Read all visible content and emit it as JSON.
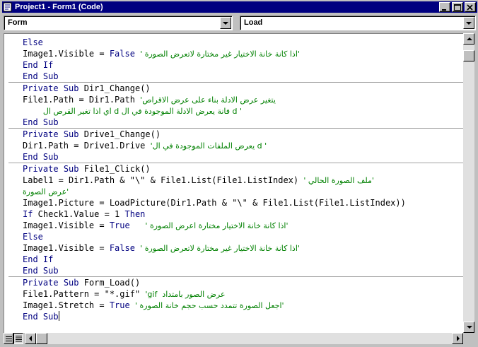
{
  "window": {
    "title": "Project1 - Form1 (Code)"
  },
  "object_combo": {
    "value": "Form"
  },
  "procedure_combo": {
    "value": "Load"
  },
  "code": {
    "lines": [
      {
        "code": "Else",
        "comment": ""
      },
      {
        "code": "Image1.Visible = False ",
        "comment": "' اذا كانة خانة الاختيار غير مختارة لاتعرض الصورة'"
      },
      {
        "code": "End If",
        "comment": ""
      },
      {
        "code": "End Sub",
        "comment": ""
      },
      {
        "separator": true
      },
      {
        "code": "Private Sub Dir1_Change()",
        "comment": ""
      },
      {
        "code": "File1.Path = Dir1.Path ",
        "comment": "'يتغير عرض الادلة بناء على عرض الاقراص"
      },
      {
        "code": "    ",
        "comment": "اي اذا تغير القرص ال d فانة يعرض الادلة الموجودة في ال d '"
      },
      {
        "code": "End Sub",
        "comment": ""
      },
      {
        "separator": true
      },
      {
        "code": "Private Sub Drive1_Change()",
        "comment": ""
      },
      {
        "code": "Dir1.Path = Drive1.Drive ",
        "comment": "'يعرض الملفات الموجودة في ال d '"
      },
      {
        "code": "End Sub",
        "comment": ""
      },
      {
        "separator": true
      },
      {
        "code": "Private Sub File1_Click()",
        "comment": ""
      },
      {
        "code": "Label1 = Dir1.Path & \"\\\" & File1.List(File1.ListIndex) ",
        "comment": "' ملف الصورة الحالي'"
      },
      {
        "code": "",
        "comment": "عرض الصورة'"
      },
      {
        "code": "Image1.Picture = LoadPicture(Dir1.Path & \"\\\" & File1.List(File1.ListIndex))",
        "comment": ""
      },
      {
        "code": "If Check1.Value = 1 Then",
        "comment": ""
      },
      {
        "code": "Image1.Visible = True   ",
        "comment": "' اذا كانة خانة الاختيار مختارة اعرض الصورة'"
      },
      {
        "code": "Else",
        "comment": ""
      },
      {
        "code": "Image1.Visible = False ",
        "comment": "' اذا كانة خانة الاختيار غير مختارة لاتعرض الصورة'"
      },
      {
        "code": "End If",
        "comment": ""
      },
      {
        "code": "End Sub",
        "comment": ""
      },
      {
        "separator": true
      },
      {
        "code": "Private Sub Form_Load()",
        "comment": ""
      },
      {
        "code": "File1.Pattern = \"*.gif\" ",
        "comment": "'gif  عرض الصور بامتداد"
      },
      {
        "code": "Image1.Stretch = True ",
        "comment": "' اجعل الصورة تتمدد حسب حجم خانة الصورة'"
      },
      {
        "code": "End Sub",
        "comment": "",
        "caret": true
      }
    ]
  },
  "icons": {
    "app": "vb-code-icon",
    "minimize": "minimize-icon",
    "maximize": "maximize-icon",
    "close": "close-icon",
    "procedure_view": "procedure-view-icon",
    "full_module_view": "full-module-view-icon"
  },
  "colors": {
    "titlebar": "#000080",
    "keyword": "#000080",
    "comment": "#008000"
  }
}
